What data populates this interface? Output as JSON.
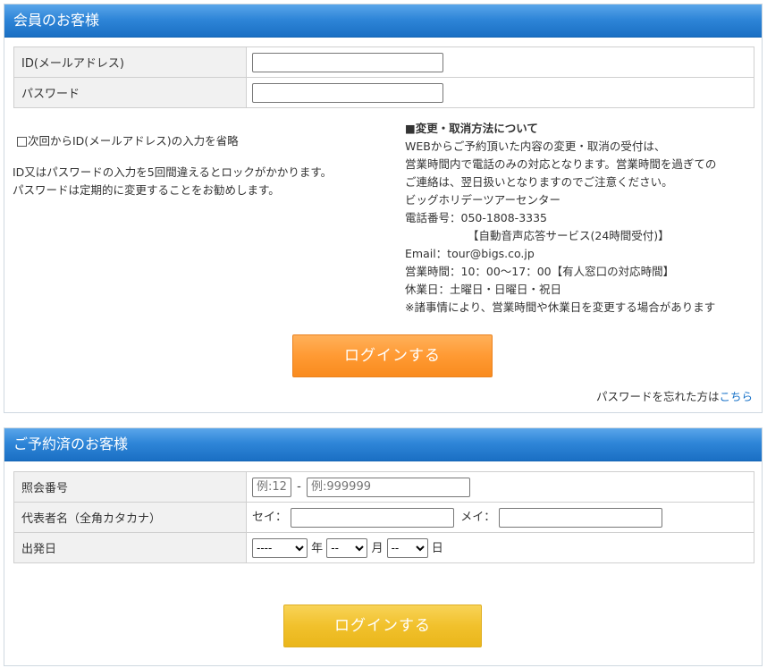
{
  "member": {
    "header": "会員のお客様",
    "id_label": "ID(メールアドレス)",
    "password_label": "パスワード",
    "remember_label": "次回からID(メールアドレス)の入力を省略",
    "lock_notice_1": "ID又はパスワードの入力を5回間違えるとロックがかかります。",
    "lock_notice_2": "パスワードは定期的に変更することをお勧めします。",
    "info_title": "■変更・取消方法について",
    "info_lines": [
      "WEBからご予約頂いた内容の変更・取消の受付は、",
      "営業時間内で電話のみの対応となります。営業時間を過ぎての",
      "ご連絡は、翌日扱いとなりますのでご注意ください。",
      "ビッグホリデーツアーセンター",
      "電話番号：050-1808-3335",
      "【自動音声応答サービス(24時間受付)】",
      "Email：tour@bigs.co.jp",
      "営業時間：10：00〜17：00【有人窓口の対応時間】",
      "休業日：土曜日・日曜日・祝日",
      "※諸事情により、営業時間や休業日を変更する場合があります"
    ],
    "login_button": "ログインする",
    "forgot_text": "パスワードを忘れた方は",
    "forgot_link": "こちら"
  },
  "reserved": {
    "header": "ご予約済のお客様",
    "ref_label": "照会番号",
    "ref_placeholder_1": "例:12",
    "ref_separator": "-",
    "ref_placeholder_2": "例:999999",
    "name_label": "代表者名（全角カタカナ）",
    "sei_label": "セイ：",
    "mei_label": "メイ：",
    "date_label": "出発日",
    "year_value": "----",
    "year_suffix": "年",
    "month_value": "--",
    "month_suffix": "月",
    "day_value": "--",
    "day_suffix": "日",
    "login_button": "ログインする"
  }
}
